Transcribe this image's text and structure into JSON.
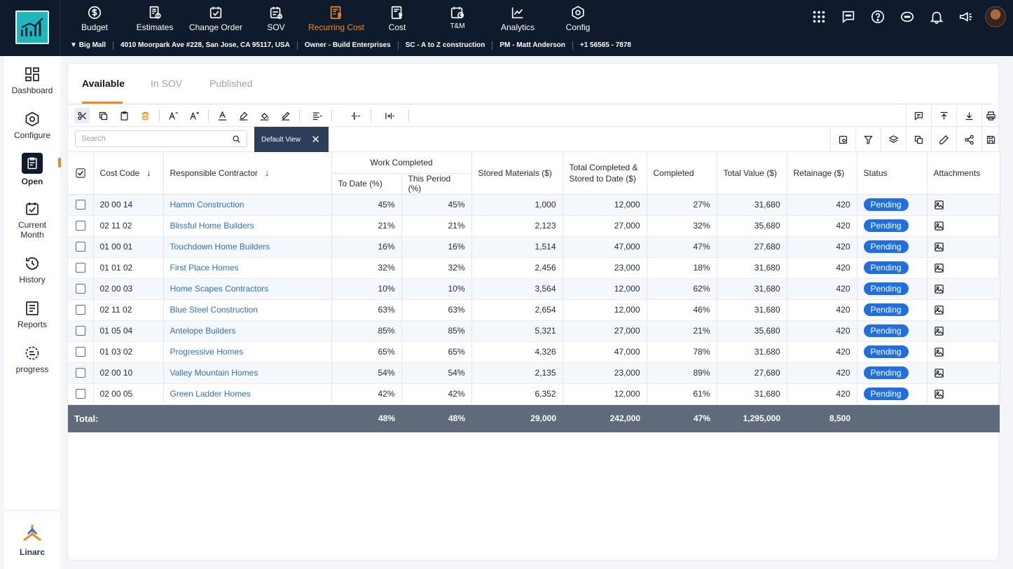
{
  "nav": [
    {
      "label": "Budget",
      "icon": "dollar-circle-icon",
      "active": false
    },
    {
      "label": "Estimates",
      "icon": "estimates-icon",
      "active": false
    },
    {
      "label": "Change Order",
      "icon": "change-order-icon",
      "active": false
    },
    {
      "label": "SOV",
      "icon": "sov-icon",
      "active": false
    },
    {
      "label": "Recurring Cost",
      "icon": "recurring-cost-icon",
      "active": true
    },
    {
      "label": "Cost",
      "icon": "cost-icon",
      "active": false
    },
    {
      "label": "T&M",
      "icon": "tm-icon",
      "active": false
    },
    {
      "label": "Analytics",
      "icon": "analytics-icon",
      "active": false
    },
    {
      "label": "Config",
      "icon": "config-icon",
      "active": false
    }
  ],
  "project": {
    "name": "Big Mall",
    "address": "4010 Moorpark Ave #228, San Jose, CA 95117, USA",
    "owner": "Owner - Build Enterprises",
    "sc": "SC - A to Z construction",
    "pm": "PM -  Matt Anderson",
    "phone": "+1 56565 - 7878"
  },
  "sidebar": {
    "dashboard": "Dashboard",
    "configure": "Configure",
    "open": "Open",
    "current_month": "Current Month",
    "history": "History",
    "reports": "Reports",
    "progress": "progress",
    "brand": "Linarc"
  },
  "tabs": {
    "available": "Available",
    "in_sov": "In SOV",
    "published": "Published"
  },
  "search": {
    "placeholder": "Search"
  },
  "view": {
    "label": "Default View",
    "close": "✕"
  },
  "table": {
    "headers": {
      "cost_code": "Cost Code",
      "contractor": "Responsible Contractor",
      "work_completed": "Work Completed",
      "to_date": "To Date (%)",
      "this_period": "This Period (%)",
      "stored": "Stored Materials ($)",
      "total_completed_1": "Total Completed &",
      "total_completed_2": "Stored to Date ($)",
      "completed": "Completed",
      "total_value": "Total Value ($)",
      "retainage": "Retainage ($)",
      "status": "Status",
      "attachments": "Attachments"
    },
    "rows": [
      {
        "code": "20 00 14",
        "contractor": "Hamm Construction",
        "to_date": "45%",
        "this_period": "45%",
        "stored": "1,000",
        "total_completed": "12,000",
        "completed": "27%",
        "total_value": "31,680",
        "retainage": "420",
        "status": "Pending"
      },
      {
        "code": "02 11 02",
        "contractor": "Blissful Home Builders",
        "to_date": "21%",
        "this_period": "21%",
        "stored": "2,123",
        "total_completed": "27,000",
        "completed": "32%",
        "total_value": "35,680",
        "retainage": "420",
        "status": "Pending"
      },
      {
        "code": "01 00 01",
        "contractor": "Touchdown Home Builders",
        "to_date": "16%",
        "this_period": "16%",
        "stored": "1,514",
        "total_completed": "47,000",
        "completed": "47%",
        "total_value": "27,680",
        "retainage": "420",
        "status": "Pending"
      },
      {
        "code": "01 01 02",
        "contractor": "First Place Homes",
        "to_date": "32%",
        "this_period": "32%",
        "stored": "2,456",
        "total_completed": "23,000",
        "completed": "18%",
        "total_value": "31,680",
        "retainage": "420",
        "status": "Pending"
      },
      {
        "code": "02 00 03",
        "contractor": "Home Scapes Contractors",
        "to_date": "10%",
        "this_period": "10%",
        "stored": "3,564",
        "total_completed": "12,000",
        "completed": "62%",
        "total_value": "31,680",
        "retainage": "420",
        "status": "Pending"
      },
      {
        "code": "02 11 02",
        "contractor": "Blue Steel Construction",
        "to_date": "63%",
        "this_period": "63%",
        "stored": "2,654",
        "total_completed": "12,000",
        "completed": "46%",
        "total_value": "31,680",
        "retainage": "420",
        "status": "Pending"
      },
      {
        "code": "01 05 04",
        "contractor": "Antelope Builders",
        "to_date": "85%",
        "this_period": "85%",
        "stored": "5,321",
        "total_completed": "27,000",
        "completed": "21%",
        "total_value": "35,680",
        "retainage": "420",
        "status": "Pending"
      },
      {
        "code": "01 03 02",
        "contractor": "Progressive Homes",
        "to_date": "65%",
        "this_period": "65%",
        "stored": "4,326",
        "total_completed": "47,000",
        "completed": "78%",
        "total_value": "31,680",
        "retainage": "420",
        "status": "Pending"
      },
      {
        "code": "02 00 10",
        "contractor": "Valley Mountain Homes",
        "to_date": "54%",
        "this_period": "54%",
        "stored": "2,135",
        "total_completed": "23,000",
        "completed": "89%",
        "total_value": "27,680",
        "retainage": "420",
        "status": "Pending"
      },
      {
        "code": "02 00 05",
        "contractor": "Green Ladder Homes",
        "to_date": "42%",
        "this_period": "42%",
        "stored": "6,352",
        "total_completed": "12,000",
        "completed": "61%",
        "total_value": "31,680",
        "retainage": "420",
        "status": "Pending"
      }
    ],
    "total": {
      "label": "Total:",
      "to_date": "48%",
      "this_period": "48%",
      "stored": "29,000",
      "total_completed": "242,000",
      "completed": "47%",
      "total_value": "1,295,000",
      "retainage": "8,500"
    }
  },
  "colors": {
    "topbar": "#0f1b2d",
    "accent": "#f08a1c",
    "link": "#2f6fc4",
    "status_pill": "#1f6fe0",
    "total_row": "#5f6b7a"
  }
}
